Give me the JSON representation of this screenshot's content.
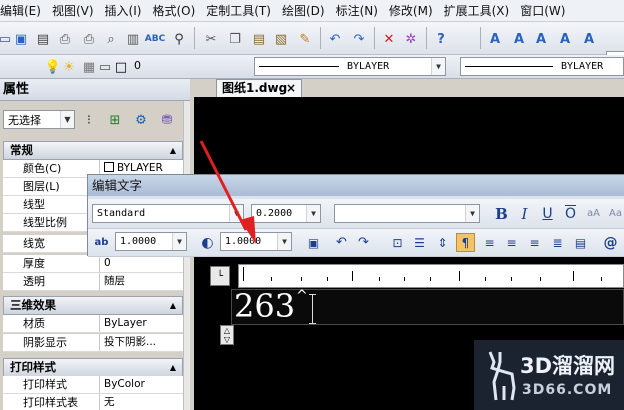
{
  "menu": [
    {
      "label": "编辑(E)"
    },
    {
      "label": "视图(V)"
    },
    {
      "label": "插入(I)"
    },
    {
      "label": "格式(O)"
    },
    {
      "label": "定制工具(T)"
    },
    {
      "label": "绘图(D)"
    },
    {
      "label": "标注(N)"
    },
    {
      "label": "修改(M)"
    },
    {
      "label": "扩展工具(X)"
    },
    {
      "label": "窗口(W)"
    }
  ],
  "toolbar": {
    "style_abbrev": "St"
  },
  "layer_bar": {
    "layer_value": "0",
    "color_value": "BYLAYER",
    "linetype_value": "BYLAYER"
  },
  "document_tab": {
    "label": "图纸1.dwg",
    "close": "×"
  },
  "properties": {
    "title": "属性",
    "selection": "无选择",
    "sections": [
      {
        "label": "常规",
        "rows": [
          {
            "key": "颜色(C)",
            "value": "BYLAYER"
          },
          {
            "key": "图层(L)",
            "value": "0"
          },
          {
            "key": "线型",
            "value": ""
          },
          {
            "key": "线型比例",
            "value": ""
          },
          {
            "key": "线宽",
            "value": ""
          },
          {
            "key": "厚度",
            "value": "0"
          },
          {
            "key": "透明",
            "value": "随层"
          }
        ]
      },
      {
        "label": "三维效果",
        "rows": [
          {
            "key": "材质",
            "value": "ByLayer"
          },
          {
            "key": "阴影显示",
            "value": "投下阴影..."
          }
        ]
      },
      {
        "label": "打印样式",
        "rows": [
          {
            "key": "打印样式",
            "value": "ByColor"
          },
          {
            "key": "打印样式表",
            "value": "无"
          }
        ]
      }
    ]
  },
  "edit_text": {
    "title": "编辑文字",
    "style": "Standard",
    "height": "0.2000",
    "font": "",
    "oblique": "1.0000",
    "width_factor": "1.0000",
    "text": "263",
    "bold": "B",
    "italic": "I",
    "underline": "U",
    "overline": "O"
  },
  "watermark": {
    "brand": "3D溜溜网",
    "site": "3D66.COM"
  },
  "colors": {
    "canvas": "#000000",
    "annotation_arrow": "#e02020",
    "panel": "#d4d0c8"
  }
}
